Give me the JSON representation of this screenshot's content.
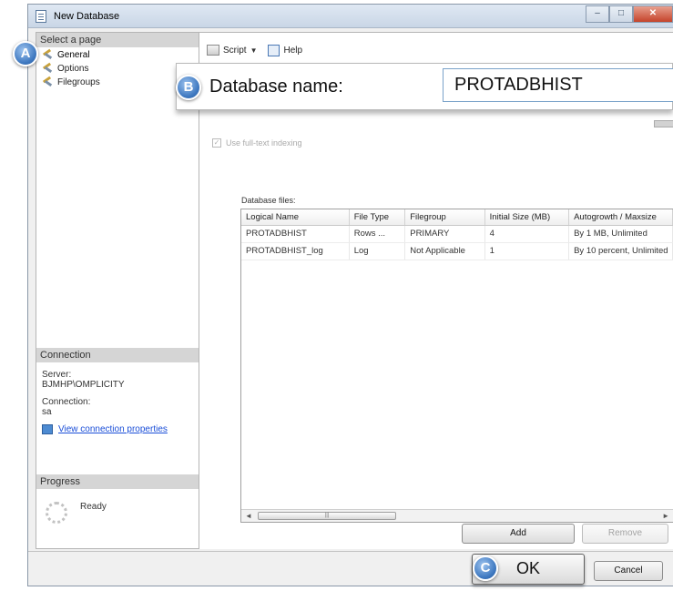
{
  "window": {
    "title": "New Database",
    "controls": {
      "minimize": "–",
      "maximize": "□",
      "close": "✕"
    }
  },
  "left_pane": {
    "header": "Select a page",
    "pages": [
      {
        "label": "General",
        "selected": true
      },
      {
        "label": "Options",
        "selected": false
      },
      {
        "label": "Filegroups",
        "selected": false
      }
    ],
    "connection": {
      "header": "Connection",
      "server_label": "Server:",
      "server_value": "BJMHP\\OMPLICITY",
      "connection_label": "Connection:",
      "connection_value": "sa",
      "link_text": "View connection properties"
    },
    "progress": {
      "header": "Progress",
      "status": "Ready"
    }
  },
  "toolbar": {
    "script_label": "Script",
    "help_label": "Help"
  },
  "general": {
    "database_name_label": "Database name:",
    "database_name_value": "PROTADBHIST",
    "fulltext_label": "Use full-text indexing",
    "fulltext_checked": true,
    "files_label": "Database files:"
  },
  "files_table": {
    "columns": [
      "Logical Name",
      "File Type",
      "Filegroup",
      "Initial Size (MB)",
      "Autogrowth / Maxsize"
    ],
    "rows": [
      [
        "PROTADBHIST",
        "Rows ...",
        "PRIMARY",
        "4",
        "By 1 MB, Unlimited"
      ],
      [
        "PROTADBHIST_log",
        "Log",
        "Not Applicable",
        "1",
        "By 10 percent, Unlimited"
      ]
    ]
  },
  "buttons": {
    "add": "Add",
    "remove": "Remove",
    "ok": "OK",
    "cancel": "Cancel"
  },
  "callouts": {
    "a": "A",
    "b": "B",
    "c": "C"
  },
  "colors": {
    "callout": "#3e78c0",
    "link": "#1a4ed8"
  }
}
